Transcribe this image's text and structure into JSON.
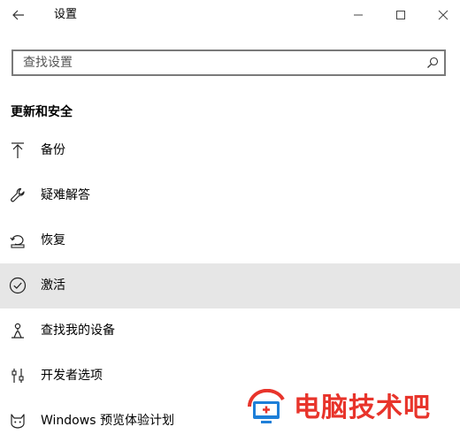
{
  "window": {
    "title": "设置"
  },
  "search": {
    "placeholder": "查找设置",
    "value": ""
  },
  "section": {
    "heading": "更新和安全"
  },
  "nav": {
    "items": [
      {
        "label": "备份",
        "icon": "backup-arrow-icon",
        "active": false
      },
      {
        "label": "疑难解答",
        "icon": "wrench-icon",
        "active": false
      },
      {
        "label": "恢复",
        "icon": "recovery-icon",
        "active": false
      },
      {
        "label": "激活",
        "icon": "check-circle-icon",
        "active": true
      },
      {
        "label": "查找我的设备",
        "icon": "find-device-icon",
        "active": false
      },
      {
        "label": "开发者选项",
        "icon": "developer-options-icon",
        "active": false
      },
      {
        "label": "Windows 预览体验计划",
        "icon": "insider-cat-icon",
        "active": false
      }
    ]
  },
  "watermark": {
    "text": "电脑技术吧"
  },
  "colors": {
    "active_row": "#e6e6e6",
    "search_border": "#7a7a7a",
    "watermark_red": "#e8342b",
    "watermark_blue": "#1e7fd8"
  }
}
